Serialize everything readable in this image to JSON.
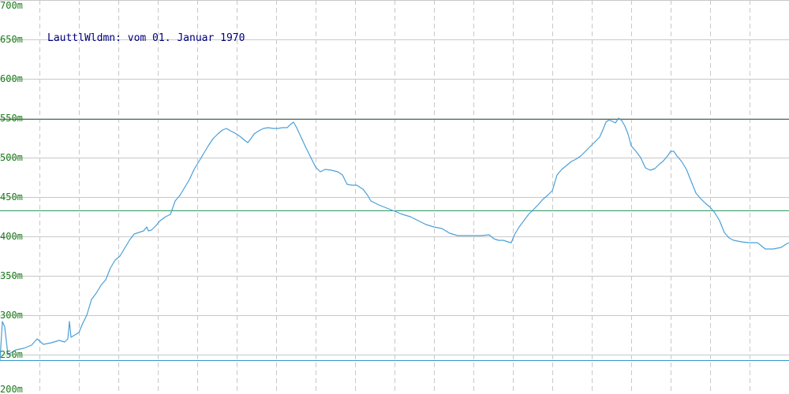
{
  "chart_data": {
    "type": "line",
    "title": "LauttlWldmn: vom 01. Januar 1970",
    "ylim": [
      200,
      700
    ],
    "y_ticks": [
      700,
      650,
      600,
      550,
      500,
      450,
      400,
      350,
      300,
      250,
      200
    ],
    "y_tick_labels": [
      "700m",
      "650m",
      "600m",
      "550m",
      "500m",
      "450m",
      "400m",
      "350m",
      "300m",
      "250m",
      "200m"
    ],
    "x_range": [
      0,
      1000
    ],
    "grid": {
      "horizontal": true,
      "vertical_dashed": true,
      "vertical_count": 20
    },
    "reference_lines": [
      {
        "value": 549,
        "color": "#2e8b2e"
      },
      {
        "value": 433,
        "color": "#2e9b62"
      },
      {
        "value": 243,
        "color": "#3399cc"
      }
    ],
    "series": [
      {
        "color": "#4a9fd8",
        "points": [
          [
            0,
            243
          ],
          [
            3,
            292
          ],
          [
            6,
            285
          ],
          [
            10,
            250
          ],
          [
            20,
            256
          ],
          [
            30,
            258
          ],
          [
            40,
            262
          ],
          [
            47,
            270
          ],
          [
            55,
            263
          ],
          [
            65,
            265
          ],
          [
            75,
            268
          ],
          [
            82,
            266
          ],
          [
            86,
            270
          ],
          [
            88,
            292
          ],
          [
            90,
            272
          ],
          [
            95,
            275
          ],
          [
            100,
            278
          ],
          [
            105,
            290
          ],
          [
            110,
            300
          ],
          [
            116,
            320
          ],
          [
            122,
            328
          ],
          [
            128,
            338
          ],
          [
            134,
            345
          ],
          [
            140,
            360
          ],
          [
            146,
            370
          ],
          [
            152,
            375
          ],
          [
            158,
            385
          ],
          [
            164,
            395
          ],
          [
            170,
            403
          ],
          [
            176,
            405
          ],
          [
            182,
            407
          ],
          [
            186,
            412
          ],
          [
            188,
            407
          ],
          [
            192,
            408
          ],
          [
            197,
            413
          ],
          [
            203,
            420
          ],
          [
            210,
            425
          ],
          [
            216,
            428
          ],
          [
            222,
            445
          ],
          [
            228,
            452
          ],
          [
            234,
            462
          ],
          [
            240,
            472
          ],
          [
            246,
            485
          ],
          [
            252,
            495
          ],
          [
            258,
            505
          ],
          [
            264,
            515
          ],
          [
            270,
            524
          ],
          [
            276,
            530
          ],
          [
            282,
            535
          ],
          [
            287,
            537
          ],
          [
            292,
            534
          ],
          [
            298,
            531
          ],
          [
            304,
            527
          ],
          [
            310,
            522
          ],
          [
            314,
            519
          ],
          [
            318,
            524
          ],
          [
            322,
            530
          ],
          [
            328,
            534
          ],
          [
            334,
            537
          ],
          [
            340,
            538
          ],
          [
            346,
            537
          ],
          [
            352,
            537
          ],
          [
            358,
            538
          ],
          [
            364,
            538
          ],
          [
            368,
            542
          ],
          [
            372,
            545
          ],
          [
            376,
            538
          ],
          [
            382,
            525
          ],
          [
            388,
            512
          ],
          [
            394,
            500
          ],
          [
            400,
            488
          ],
          [
            406,
            482
          ],
          [
            412,
            485
          ],
          [
            420,
            484
          ],
          [
            428,
            482
          ],
          [
            434,
            478
          ],
          [
            440,
            466
          ],
          [
            446,
            465
          ],
          [
            452,
            465
          ],
          [
            460,
            460
          ],
          [
            466,
            452
          ],
          [
            470,
            445
          ],
          [
            480,
            440
          ],
          [
            490,
            436
          ],
          [
            500,
            432
          ],
          [
            510,
            428
          ],
          [
            520,
            425
          ],
          [
            530,
            420
          ],
          [
            540,
            415
          ],
          [
            550,
            412
          ],
          [
            560,
            410
          ],
          [
            570,
            404
          ],
          [
            580,
            401
          ],
          [
            590,
            401
          ],
          [
            600,
            401
          ],
          [
            610,
            401
          ],
          [
            620,
            402
          ],
          [
            626,
            397
          ],
          [
            632,
            395
          ],
          [
            638,
            395
          ],
          [
            644,
            393
          ],
          [
            648,
            392
          ],
          [
            652,
            402
          ],
          [
            658,
            412
          ],
          [
            664,
            420
          ],
          [
            670,
            428
          ],
          [
            676,
            434
          ],
          [
            682,
            440
          ],
          [
            688,
            447
          ],
          [
            694,
            452
          ],
          [
            700,
            458
          ],
          [
            706,
            478
          ],
          [
            712,
            485
          ],
          [
            718,
            490
          ],
          [
            724,
            495
          ],
          [
            730,
            498
          ],
          [
            736,
            502
          ],
          [
            742,
            508
          ],
          [
            748,
            514
          ],
          [
            754,
            520
          ],
          [
            760,
            526
          ],
          [
            764,
            535
          ],
          [
            768,
            545
          ],
          [
            772,
            548
          ],
          [
            776,
            546
          ],
          [
            780,
            544
          ],
          [
            784,
            550
          ],
          [
            788,
            547
          ],
          [
            792,
            540
          ],
          [
            796,
            530
          ],
          [
            800,
            515
          ],
          [
            806,
            508
          ],
          [
            812,
            500
          ],
          [
            818,
            487
          ],
          [
            824,
            484
          ],
          [
            830,
            486
          ],
          [
            836,
            492
          ],
          [
            840,
            495
          ],
          [
            846,
            502
          ],
          [
            850,
            508
          ],
          [
            854,
            508
          ],
          [
            858,
            502
          ],
          [
            864,
            495
          ],
          [
            870,
            485
          ],
          [
            876,
            470
          ],
          [
            882,
            455
          ],
          [
            888,
            448
          ],
          [
            894,
            442
          ],
          [
            900,
            437
          ],
          [
            906,
            430
          ],
          [
            912,
            420
          ],
          [
            918,
            405
          ],
          [
            924,
            398
          ],
          [
            930,
            395
          ],
          [
            940,
            393
          ],
          [
            950,
            392
          ],
          [
            960,
            392
          ],
          [
            965,
            388
          ],
          [
            970,
            384
          ],
          [
            980,
            384
          ],
          [
            990,
            386
          ],
          [
            996,
            390
          ],
          [
            1000,
            392
          ]
        ]
      }
    ]
  }
}
